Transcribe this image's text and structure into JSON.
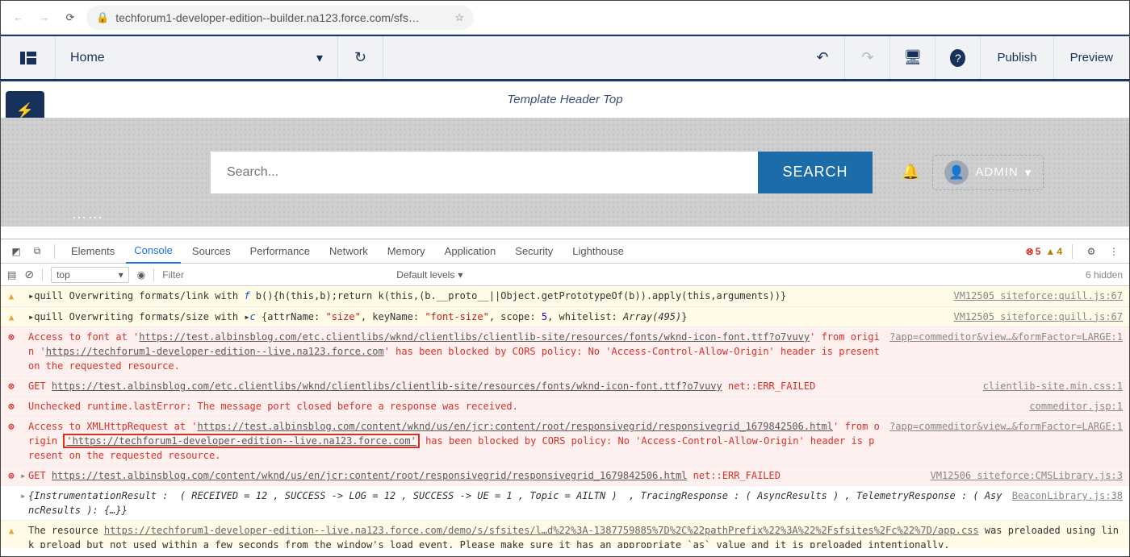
{
  "browser": {
    "url": "techforum1-developer-edition--builder.na123.force.com/sfs…"
  },
  "toolbar": {
    "page_label": "Home",
    "publish": "Publish",
    "preview": "Preview"
  },
  "canvas": {
    "template_header": "Template Header Top",
    "search_placeholder": "Search...",
    "search_button": "SEARCH",
    "admin_label": "ADMIN"
  },
  "devtools": {
    "tabs": [
      "Elements",
      "Console",
      "Sources",
      "Performance",
      "Network",
      "Memory",
      "Application",
      "Security",
      "Lighthouse"
    ],
    "active_tab": "Console",
    "error_count": "5",
    "warn_count": "4",
    "context": "top",
    "filter_placeholder": "Filter",
    "levels": "Default levels",
    "hidden": "6 hidden",
    "rows": [
      {
        "type": "warn",
        "src": "VM12505 siteforce:quill.js:67",
        "parts": [
          "▸",
          "quill Overwriting formats/link with ",
          "f",
          " b(){h(this,b);return k(this,(b.__proto__||Object.getPrototypeOf(b)).apply(this,arguments))}"
        ]
      },
      {
        "type": "warn",
        "src": "VM12505 siteforce:quill.js:67",
        "parts": [
          "▸",
          "quill Overwriting formats/size with ▸",
          "c",
          " {attrName: ",
          "\"size\"",
          ", keyName: ",
          "\"font-size\"",
          ", scope: ",
          "5",
          ", whitelist: ",
          "Array(495)",
          "}"
        ]
      },
      {
        "type": "err",
        "src": "?app=commeditor&view…&formFactor=LARGE:1",
        "parts": [
          "Access to font at '",
          "https://test.albinsblog.com/etc.clientlibs/wknd/clientlibs/clientlib-site/resources/fonts/wknd-icon-font.ttf?o7vuvy",
          "' from origin '",
          "https://techforum1-developer-edition--live.na123.force.com",
          "' has been blocked by CORS policy: No 'Access-Control-Allow-Origin' header is present on the requested resource."
        ]
      },
      {
        "type": "err",
        "src": "clientlib-site.min.css:1",
        "parts": [
          "GET ",
          "https://test.albinsblog.com/etc.clientlibs/wknd/clientlibs/clientlib-site/resources/fonts/wknd-icon-font.ttf?o7vuvy",
          " net::ERR_FAILED"
        ]
      },
      {
        "type": "err",
        "src": "commeditor.jsp:1",
        "parts": [
          "Unchecked runtime.lastError: The message port closed before a response was received."
        ]
      },
      {
        "type": "err",
        "src": "?app=commeditor&view…&formFactor=LARGE:1",
        "parts": [
          "Access to XMLHttpRequest at '",
          "https://test.albinsblog.com/content/wknd/us/en/jcr:content/root/responsivegrid/responsivegrid_1679842506.html",
          "' from origin ",
          "BOX:'https://techforum1-developer-edition--live.na123.force.com'",
          " has been blocked by CORS policy: No 'Access-Control-Allow-Origin' header is present on the requested resource."
        ]
      },
      {
        "type": "err",
        "src": "VM12506 siteforce:CMSLibrary.js:3",
        "caret": "▸",
        "parts": [
          "GET ",
          "https://test.albinsblog.com/content/wknd/us/en/jcr:content/root/responsivegrid/responsivegrid_1679842506.html",
          " net::ERR_FAILED"
        ]
      },
      {
        "type": "plain",
        "src": "BeaconLibrary.js:38",
        "caret": "▸",
        "parts": [
          "{InstrumentationResult :  ( RECEIVED = 12 , SUCCESS -> LOG = 12 , SUCCESS -> UE = 1 , Topic = AILTN )  , TracingResponse : ( AsyncResults ) , TelemetryResponse : ( AsyncResults ): {…}}"
        ]
      },
      {
        "type": "warn",
        "src": "",
        "parts": [
          "The resource ",
          "https://techforum1-developer-edition--live.na123.force.com/demo/s/sfsites/l…d%22%3A-1387759885%7D%2C%22pathPrefix%22%3A%22%2Fsfsites%2Fc%22%7D/app.css",
          " was preloaded using link preload but not used within a few seconds from the window's load event. Please make sure it has an appropriate `as` value and it is preloaded intentionally."
        ]
      }
    ]
  }
}
